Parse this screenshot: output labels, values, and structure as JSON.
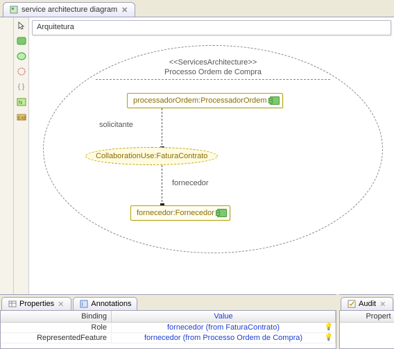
{
  "tab": {
    "title": "service architecture diagram"
  },
  "breadcrumb": "Arquitetura",
  "diagram": {
    "stereotype": "<<ServicesArchitecture>>",
    "name": "Processo Ordem de Compra",
    "nodes": {
      "processador": "processadorOrdem:ProcessadorOrdem",
      "collab": "CollaborationUse:FaturaContrato",
      "fornecedor": "fornecedor:Fornecedor"
    },
    "edges": {
      "solicitante": "solicitante",
      "fornecedor": "fornecedor"
    }
  },
  "panels": {
    "properties": {
      "tab1": "Properties",
      "tab2": "Annotations",
      "columns": {
        "c1": "Binding",
        "c2": "Value"
      },
      "rows": [
        {
          "binding": "Role",
          "value": "fornecedor (from FaturaContrato)"
        },
        {
          "binding": "RepresentedFeature",
          "value": "fornecedor (from Processo Ordem de Compra)"
        }
      ]
    },
    "audit": {
      "tab": "Audit",
      "column": "Propert"
    }
  }
}
